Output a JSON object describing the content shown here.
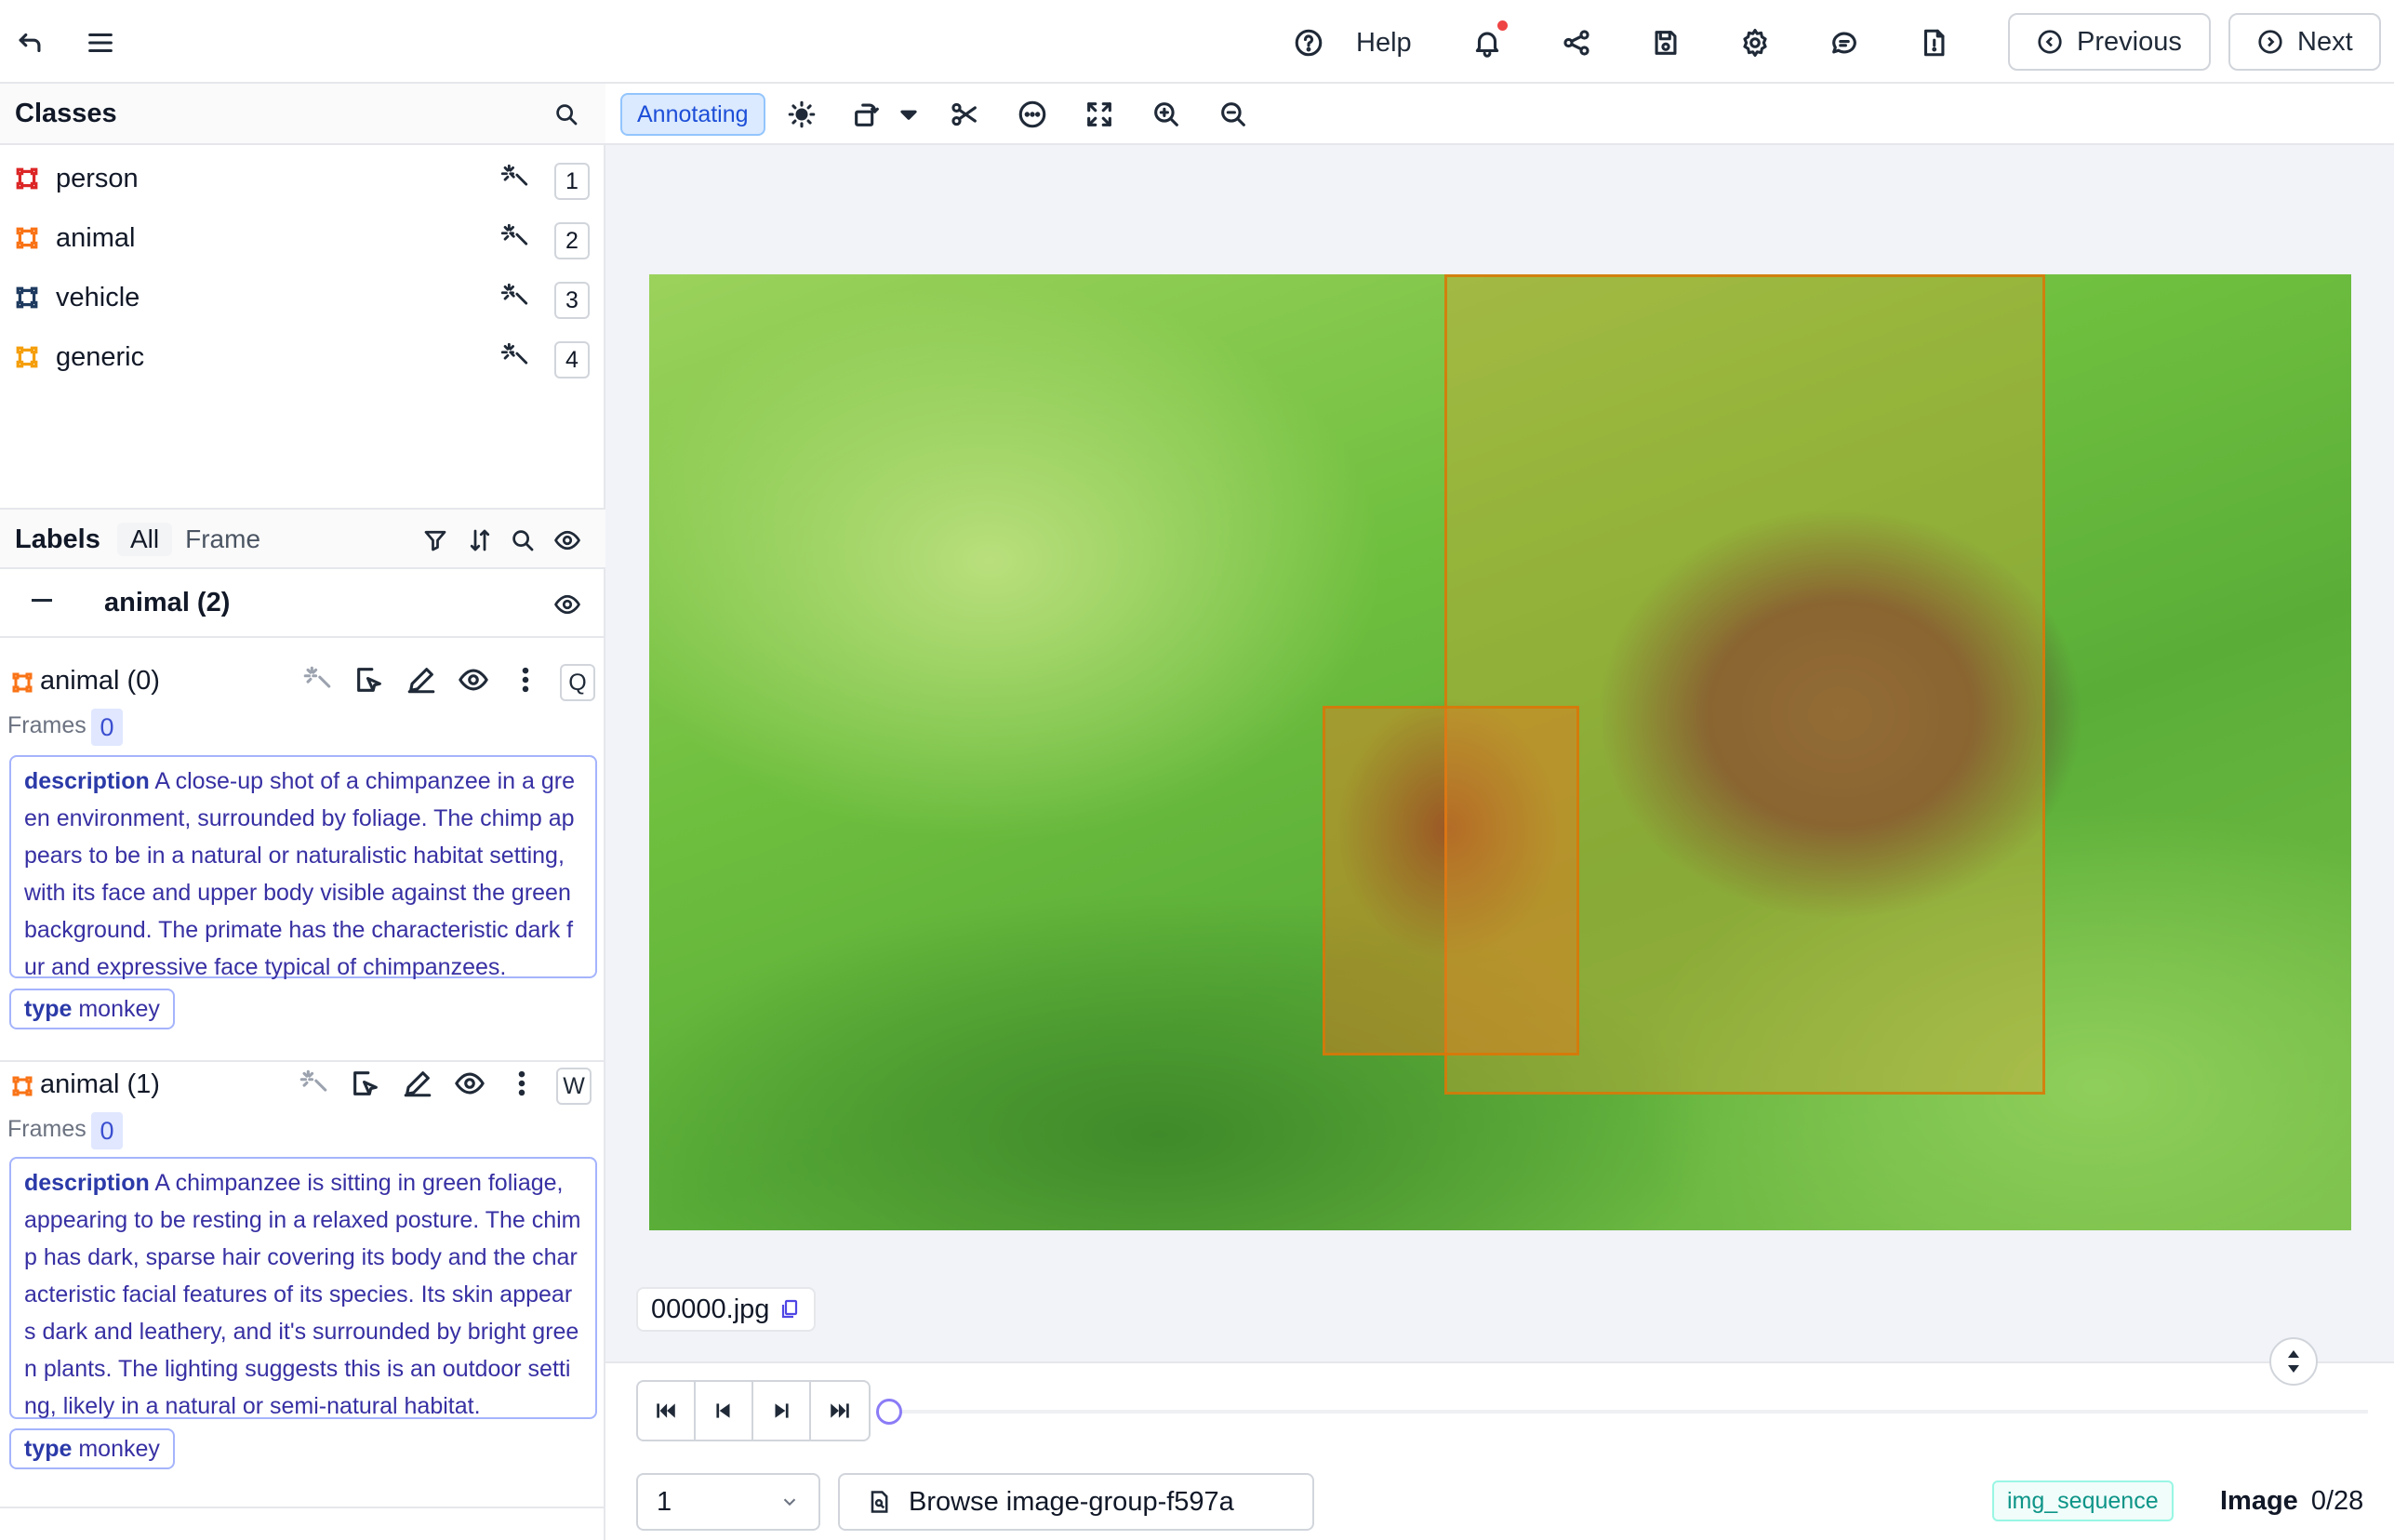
{
  "topbar": {
    "help_label": "Help",
    "previous_label": "Previous",
    "next_label": "Next"
  },
  "classes": {
    "title": "Classes",
    "items": [
      {
        "name": "person",
        "key": "1",
        "color": "#dc2626"
      },
      {
        "name": "animal",
        "key": "2",
        "color": "#f97316"
      },
      {
        "name": "vehicle",
        "key": "3",
        "color": "#1e3a5f"
      },
      {
        "name": "generic",
        "key": "4",
        "color": "#f59e0b"
      }
    ]
  },
  "labels": {
    "title": "Labels",
    "tab_all": "All",
    "tab_frame": "Frame",
    "group_name": "animal (2)",
    "items": [
      {
        "title": "animal (0)",
        "key": "Q",
        "frames_label": "Frames",
        "frames_value": "0",
        "desc_key": "description",
        "desc_text": "A close-up shot of a chimpanzee in a green environment, surrounded by foliage. The chimp appears to be in a natural or naturalistic habitat setting, with its face and upper body visible against the green background. The primate has the characteristic dark fur and expressive face typical of chimpanzees.",
        "type_key": "type",
        "type_value": "monkey"
      },
      {
        "title": "animal (1)",
        "key": "W",
        "frames_label": "Frames",
        "frames_value": "0",
        "desc_key": "description",
        "desc_text": "A chimpanzee is sitting in green foliage, appearing to be resting in a relaxed posture. The chimp has dark, sparse hair covering its body and the characteristic facial features of its species. Its skin appears dark and leathery, and it's surrounded by bright green plants. The lighting suggests this is an outdoor setting, likely in a natural or semi-natural habitat.",
        "type_key": "type",
        "type_value": "monkey"
      }
    ]
  },
  "editor": {
    "mode_label": "Annotating",
    "filename": "00000.jpg",
    "frame_value": "1",
    "browse_label": "Browse image-group-f597a",
    "sequence_tag": "img_sequence",
    "image_label": "Image",
    "image_counter": "0/28"
  }
}
